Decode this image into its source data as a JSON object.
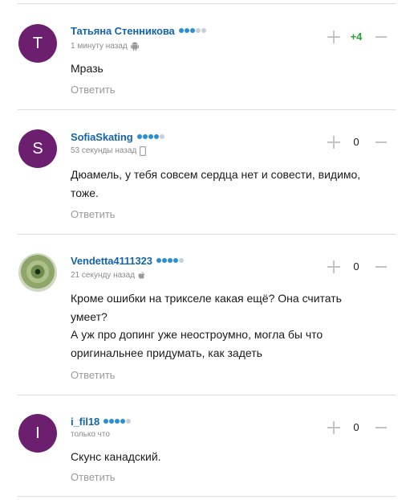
{
  "comments": [
    {
      "author": "Татьяна Стенникова",
      "avatar_letter": "Т",
      "rating_dots": 5,
      "rating_filled": 3,
      "time": "1 минуту назад",
      "device_icon": "android-icon",
      "lines": [
        "Мразь"
      ],
      "reply": "Ответить",
      "score": "+4",
      "score_positive": true
    },
    {
      "author": "SofiaSkating",
      "avatar_letter": "S",
      "rating_dots": 5,
      "rating_filled": 4,
      "time": "53 секунды назад",
      "device_icon": "mobile-phone-icon",
      "lines": [
        "Дюамель, у тебя совсем сердца нет и совести, видимо,",
        "тоже."
      ],
      "reply": "Ответить",
      "score": "0",
      "score_positive": false
    },
    {
      "author": "Vendetta4111323",
      "avatar_letter": "",
      "avatar_photo": true,
      "rating_dots": 5,
      "rating_filled": 4,
      "time": "21 секунду назад",
      "device_icon": "apple-icon",
      "lines": [
        "Кроме ошибки на трикселе какая ещё? Она считать",
        "умеет?",
        "А уж про допинг уже неостроумно, могла бы что",
        "оригинальнее придумать, как задеть"
      ],
      "reply": "Ответить",
      "score": "0",
      "score_positive": false
    },
    {
      "author": "i_fil18",
      "avatar_letter": "I",
      "rating_dots": 5,
      "rating_filled": 4,
      "time": "только что",
      "device_icon": "",
      "lines": [
        "Скунс канадский."
      ],
      "reply": "Ответить",
      "score": "0",
      "score_positive": false
    }
  ],
  "colors": {
    "author_link": "#1565a8",
    "avatar_bg": "#6b1f6e",
    "rating_dot": "#2b8fd6",
    "score_positive": "#27a33b",
    "reply_text": "#9a9a9a"
  }
}
